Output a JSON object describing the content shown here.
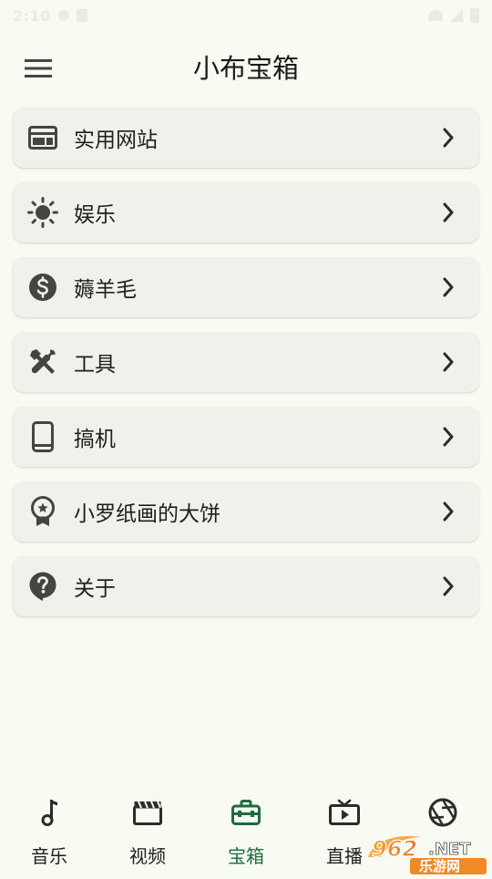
{
  "status_bar": {
    "time": "2:10"
  },
  "app_bar": {
    "menu_icon": "hamburger-menu-icon",
    "title": "小布宝箱"
  },
  "items": [
    {
      "label": "实用网站",
      "icon": "web-icon"
    },
    {
      "label": "娱乐",
      "icon": "sun-icon"
    },
    {
      "label": "薅羊毛",
      "icon": "dollar-circle-icon"
    },
    {
      "label": "工具",
      "icon": "tools-icon"
    },
    {
      "label": "搞机",
      "icon": "phone-icon"
    },
    {
      "label": "小罗纸画的大饼",
      "icon": "award-icon"
    },
    {
      "label": "关于",
      "icon": "help-bubble-icon"
    }
  ],
  "bottom_nav": [
    {
      "label": "音乐",
      "icon": "music-note-icon"
    },
    {
      "label": "视频",
      "icon": "clapperboard-icon"
    },
    {
      "label": "宝箱",
      "icon": "toolbox-icon",
      "active": true
    },
    {
      "label": "直播",
      "icon": "tv-icon"
    },
    {
      "label": "",
      "icon": "aperture-icon"
    }
  ],
  "watermark": {
    "brand_962": "962",
    "net": ".NET",
    "site": "乐游网"
  },
  "colors": {
    "background": "#f8fbf1",
    "card": "#eff2ea",
    "active_nav": "#1f6b3c",
    "icon": "#424542"
  }
}
